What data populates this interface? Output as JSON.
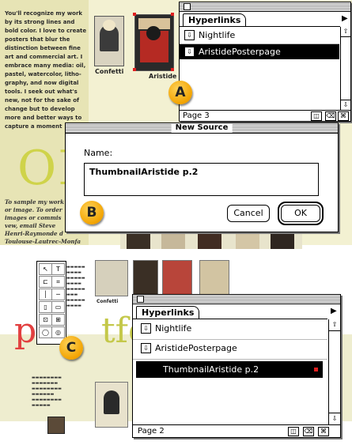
{
  "background_doc": {
    "body_text": "You'll recognize my work\nby its strong lines and\nbold color. I love to create\nposters that blur the\ndistinction between fine\nart and commercial art. I\nembrace many media: oil,\npastel, watercolor, litho-\ngraphy, and now digital\ntools. I seek out what's\nnew, not for the sake of\nchange but to develop\nmore and better ways to\ncapture a moment",
    "body_text2": "To sample my work\nor image. To order\nimages or commis\nvew, email Steve\nHenri-Raymonde d\nToulouse-Lautrec-Monfa",
    "big_letters": "OI",
    "thumb_caption_1": "Confetti",
    "thumb_caption_2": "Aristide Br"
  },
  "top_panel": {
    "tab_label": "Hyperlinks",
    "items": [
      {
        "label": "Nightlife",
        "selected": false
      },
      {
        "label": "AristidePosterpage",
        "selected": true
      }
    ],
    "page_label": "Page 3"
  },
  "dialog": {
    "title": "New Source",
    "name_label": "Name:",
    "name_value": "ThumbnailAristide p.2",
    "cancel_label": "Cancel",
    "ok_label": "OK"
  },
  "bottom_panel": {
    "tab_label": "Hyperlinks",
    "items": [
      {
        "label": "Nightlife",
        "selected": false
      },
      {
        "label": "AristidePosterpage",
        "selected": false
      },
      {
        "label": "ThumbnailAristide p.2",
        "selected": true
      }
    ],
    "page_label": "Page 2"
  },
  "bottom_doc": {
    "word_part1": "p",
    "word_part2": "tfo",
    "caption": "Confetti"
  },
  "callouts": {
    "a": "A",
    "b": "B",
    "c": "C"
  },
  "colors": {
    "callout": "#f2a300",
    "selection_handle": "#e02020",
    "portfolio_red": "#e24040"
  }
}
